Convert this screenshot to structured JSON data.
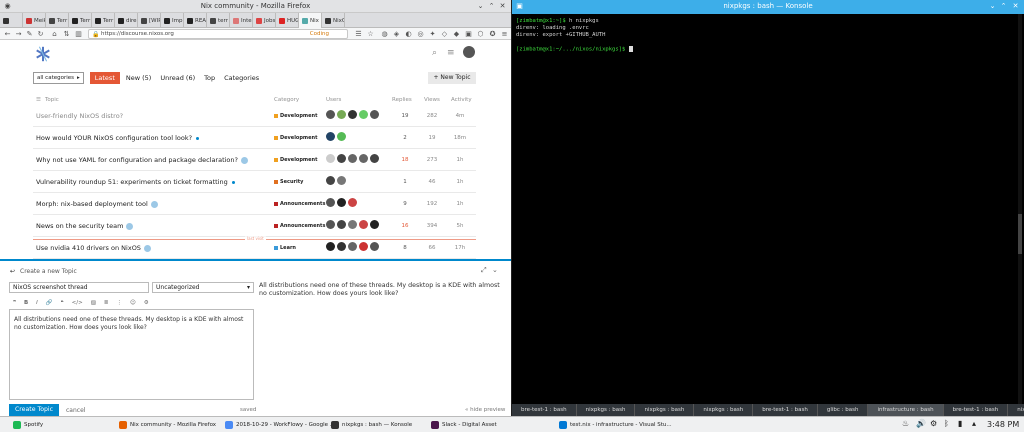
{
  "firefox": {
    "window_title": "Nix community - Mozilla Firefox",
    "tabs": [
      {
        "label": "",
        "color": "#333"
      },
      {
        "label": "Meik",
        "color": "#c33"
      },
      {
        "label": "Terr",
        "color": "#444"
      },
      {
        "label": "Terr",
        "color": "#222"
      },
      {
        "label": "Terr",
        "color": "#222"
      },
      {
        "label": "dire",
        "color": "#222"
      },
      {
        "label": "[WIP",
        "color": "#444"
      },
      {
        "label": "Impl",
        "color": "#222"
      },
      {
        "label": "READ",
        "color": "#222"
      },
      {
        "label": "terr",
        "color": "#444"
      },
      {
        "label": "Inter",
        "color": "#d77"
      },
      {
        "label": "Jobs",
        "color": "#d44"
      },
      {
        "label": "HUG",
        "color": "#d22"
      },
      {
        "label": "Nix",
        "color": "#5aa"
      },
      {
        "label": "NixO",
        "color": "#333"
      }
    ],
    "url": "https://discourse.nixos.org",
    "coding_label": "Coding"
  },
  "discourse": {
    "filters": {
      "category": "all categories",
      "latest": "Latest",
      "new": "New (5)",
      "unread": "Unread (6)",
      "top": "Top",
      "categories": "Categories"
    },
    "new_topic": "+ New Topic",
    "columns": {
      "topic": "Topic",
      "category": "Category",
      "users": "Users",
      "replies": "Replies",
      "views": "Views",
      "activity": "Activity"
    },
    "topics": [
      {
        "title": "User-friendly NixOS distro?",
        "category": "Development",
        "cat_color": "#f0a020",
        "replies": "19",
        "views": "282",
        "activity": "4m",
        "read": true,
        "dot": false,
        "badge": false,
        "hot": false,
        "users": [
          "#555",
          "#7a5",
          "#333",
          "#6c6",
          "#555"
        ]
      },
      {
        "title": "How would YOUR NixOS configuration tool look?",
        "category": "Development",
        "cat_color": "#f0a020",
        "replies": "2",
        "views": "19",
        "activity": "18m",
        "read": false,
        "dot": true,
        "badge": false,
        "hot": false,
        "users": [
          "#246",
          "#5b5"
        ]
      },
      {
        "title": "Why not use YAML for configuration and package declaration?",
        "category": "Development",
        "cat_color": "#f0a020",
        "replies": "18",
        "views": "273",
        "activity": "1h",
        "read": false,
        "dot": false,
        "badge": true,
        "hot": true,
        "users": [
          "#ccc",
          "#444",
          "#666",
          "#666",
          "#444"
        ]
      },
      {
        "title": "Vulnerability roundup 51: experiments on ticket formatting",
        "category": "Security",
        "cat_color": "#e07020",
        "replies": "1",
        "views": "46",
        "activity": "1h",
        "read": false,
        "dot": true,
        "badge": false,
        "hot": false,
        "users": [
          "#444",
          "#777"
        ]
      },
      {
        "title": "Morph: nix-based deployment tool",
        "category": "Announcements",
        "cat_color": "#b22",
        "replies": "9",
        "views": "192",
        "activity": "1h",
        "read": false,
        "dot": false,
        "badge": true,
        "hot": false,
        "users": [
          "#555",
          "#222",
          "#c44"
        ]
      },
      {
        "title": "News on the security team",
        "category": "Announcements",
        "cat_color": "#b22",
        "replies": "16",
        "views": "394",
        "activity": "5h",
        "read": false,
        "dot": false,
        "badge": true,
        "hot": true,
        "users": [
          "#555",
          "#444",
          "#777",
          "#c44",
          "#222"
        ]
      },
      {
        "title": "Use nvidia 410 drivers on NixOS",
        "category": "Learn",
        "cat_color": "#3a9ad9",
        "replies": "8",
        "views": "66",
        "activity": "17h",
        "read": false,
        "dot": false,
        "badge": true,
        "hot": false,
        "users": [
          "#222",
          "#333",
          "#666",
          "#c33",
          "#555"
        ]
      }
    ],
    "last_visit": "last visit",
    "composer": {
      "header": "Create a new Topic",
      "title_value": "NixOS screenshot thread",
      "category_value": "Uncategorized",
      "body": "All distributions need one of these threads. My desktop is a KDE with almost no customization. How does yours look like?",
      "preview": "All distributions need one of these threads. My desktop is a KDE with almost no customization. How does yours look like?",
      "create_button": "Create Topic",
      "cancel": "cancel",
      "saved": "saved",
      "hide_preview": "« hide preview"
    }
  },
  "konsole": {
    "window_title": "nixpkgs : bash — Konsole",
    "lines": [
      {
        "prompt": "[zimbatm@x1:~]$",
        "cmd": " h nixpkgs"
      },
      {
        "prompt": "",
        "cmd": "direnv: loading .envrc"
      },
      {
        "prompt": "",
        "cmd": "direnv: export +GITHUB_AUTH"
      },
      {
        "prompt": "",
        "cmd": ""
      },
      {
        "prompt": "[zimbatm@x1:~/.../nixos/nixpkgs]$",
        "cmd": " "
      }
    ],
    "tabs": [
      "bre-test-1 : bash",
      "nixpkgs : bash",
      "nixpkgs : bash",
      "nixpkgs : bash",
      "bre-test-1 : bash",
      "glibc : bash",
      "infrastructure : bash",
      "bre-test-1 : bash",
      "nixpkgs : bash"
    ],
    "active_tab": 6
  },
  "taskbar": {
    "items": [
      {
        "label": "Spotify",
        "color": "#1db954"
      },
      {
        "label": "Nix community - Mozilla Firefox",
        "color": "#e66000"
      },
      {
        "label": "2018-10-29 - WorkFlowy - Google ...",
        "color": "#4a8af4"
      },
      {
        "label": "nixpkgs : bash — Konsole",
        "color": "#333"
      },
      {
        "label": "Slack - Digital Asset",
        "color": "#4a154b"
      },
      {
        "label": "test.nix - infrastructure - Visual Stu...",
        "color": "#0078d4"
      }
    ],
    "clock": "3:48 PM"
  }
}
